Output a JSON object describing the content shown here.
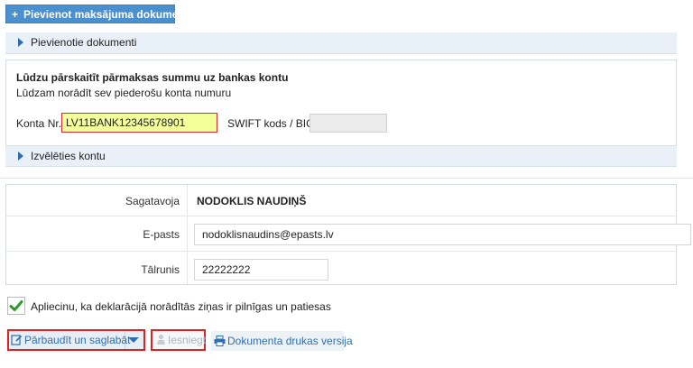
{
  "add_document_button": {
    "icon": "plus-icon",
    "label": "Pievienot maksājuma dokumentu"
  },
  "attached_documents": {
    "label": "Pievienotie dokumenti"
  },
  "bank": {
    "title": "Lūdzu pārskaitīt pārmaksas summu uz bankas kontu",
    "subtitle": "Lūdzam norādīt sev piederošu konta numuru",
    "account_label": "Konta Nr.",
    "account_value": "LV11BANK12345678901",
    "swift_label": "SWIFT kods / BIC",
    "swift_value": "",
    "choose_account_label": "Izvēlēties kontu"
  },
  "contact": {
    "preparer_label": "Sagatavoja",
    "preparer_name": "NODOKLIS NAUDIŅŠ",
    "email_label": "E-pasts",
    "email_value": "nodoklisnaudins@epasts.lv",
    "phone_label": "Tālrunis",
    "phone_value": "22222222"
  },
  "confirm": {
    "checked": true,
    "label": "Apliecinu, ka deklarācijā norādītās ziņas ir pilnīgas un patiesas"
  },
  "actions": {
    "check_save_label": "Pārbaudīt un saglabāt",
    "submit_label": "Iesniegt",
    "print_label": "Dokumenta drukas versija"
  },
  "colors": {
    "accent": "#4a8fce",
    "link": "#2f6fb0",
    "highlight_field": "#f2ff9a",
    "error_border": "#d22222"
  }
}
